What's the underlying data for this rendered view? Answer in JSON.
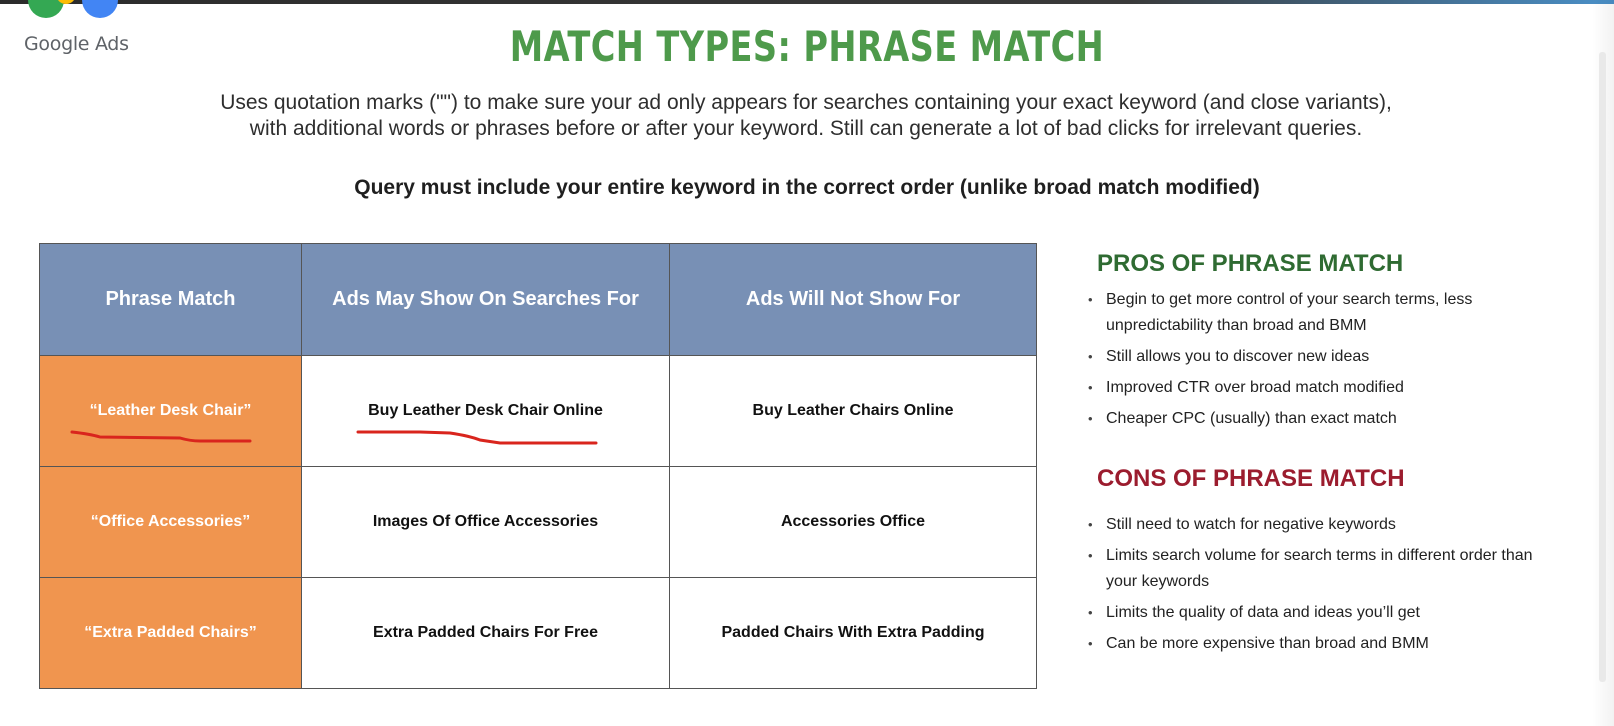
{
  "logo": {
    "text": "Google Ads",
    "colors": [
      "#34a853",
      "#fbbc04",
      "#4285f4"
    ]
  },
  "title": "MATCH TYPES: PHRASE MATCH",
  "intro": "Uses quotation marks (\"\") to make sure your ad only appears for searches containing your exact keyword (and close variants), with additional words or phrases before or after your keyword. Still can generate a lot of bad clicks for irrelevant queries.",
  "intro_bold": "Query must include your entire keyword in the correct order (unlike broad match modified)",
  "table": {
    "headers": [
      "Phrase Match",
      "Ads May Show On Searches For",
      "Ads Will Not Show For"
    ],
    "rows": [
      [
        "“Leather Desk Chair”",
        "Buy Leather Desk Chair Online",
        "Buy Leather Chairs Online"
      ],
      [
        "“Office Accessories”",
        "Images Of Office Accessories",
        "Accessories Office"
      ],
      [
        "“Extra Padded Chairs”",
        "Extra Padded Chairs For Free",
        "Padded Chairs With Extra Padding"
      ]
    ],
    "header_color": "#7890b5",
    "keyword_color": "#f0954f",
    "annotation_color": "#d9251d"
  },
  "pros": {
    "heading": "PROS OF PHRASE MATCH",
    "items": [
      "Begin to get more control of your search terms, less unpredictability than broad and BMM",
      "Still allows you to discover new ideas",
      "Improved CTR over broad match modified",
      "Cheaper CPC (usually) than exact match"
    ]
  },
  "cons": {
    "heading": "CONS OF PHRASE MATCH",
    "items": [
      "Still need to watch for negative keywords",
      "Limits search volume for search terms in different order than your keywords",
      "Limits the quality of data and ideas you’ll get",
      "Can be more expensive than broad and BMM"
    ]
  }
}
